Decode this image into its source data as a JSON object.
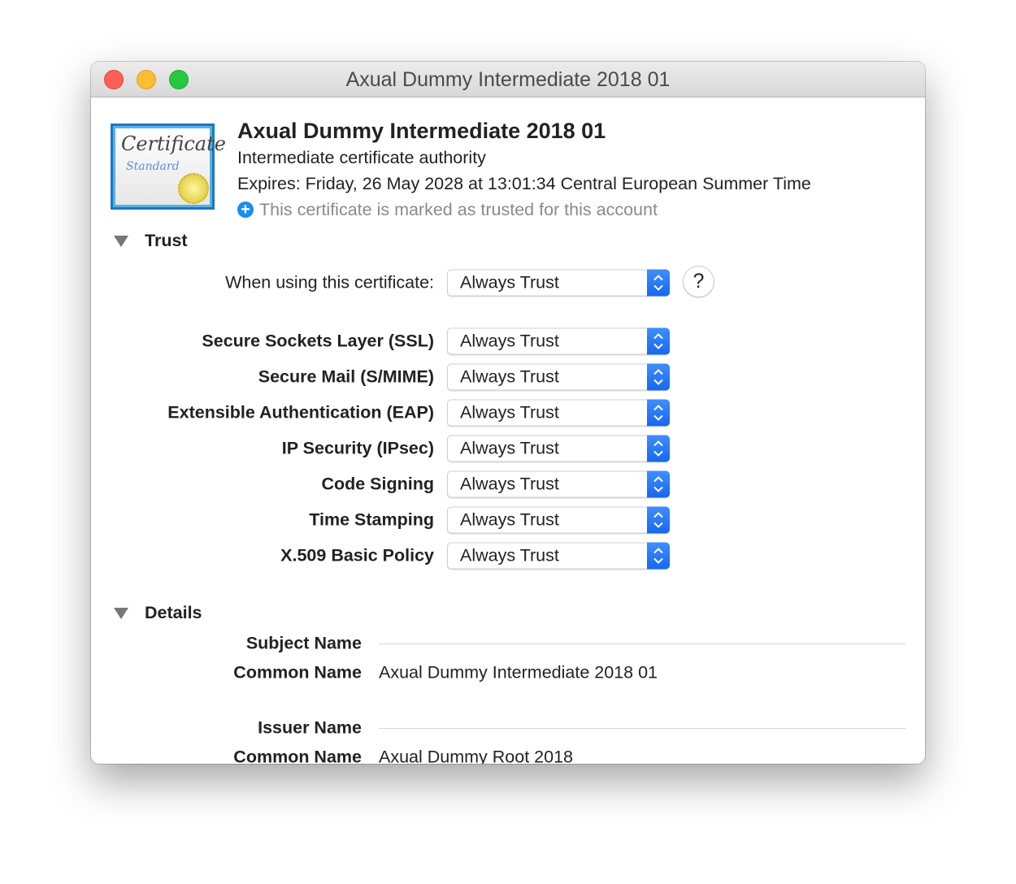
{
  "window": {
    "title": "Axual Dummy Intermediate 2018 01"
  },
  "header": {
    "icon": {
      "name": "certificate-standard-icon",
      "text": [
        "Certificate",
        "Standard"
      ]
    },
    "name": "Axual Dummy Intermediate 2018 01",
    "type": "Intermediate certificate authority",
    "expires": "Expires: Friday, 26 May 2028 at 13:01:34 Central European Summer Time",
    "trust_status": "This certificate is marked as trusted for this account"
  },
  "trust": {
    "label": "Trust",
    "when_using_label": "When using this certificate:",
    "when_using_value": "Always Trust",
    "help": "?",
    "policies": [
      {
        "label": "Secure Sockets Layer (SSL)",
        "value": "Always Trust"
      },
      {
        "label": "Secure Mail (S/MIME)",
        "value": "Always Trust"
      },
      {
        "label": "Extensible Authentication (EAP)",
        "value": "Always Trust"
      },
      {
        "label": "IP Security (IPsec)",
        "value": "Always Trust"
      },
      {
        "label": "Code Signing",
        "value": "Always Trust"
      },
      {
        "label": "Time Stamping",
        "value": "Always Trust"
      },
      {
        "label": "X.509 Basic Policy",
        "value": "Always Trust"
      }
    ]
  },
  "details": {
    "label": "Details",
    "subject_header": "Subject Name",
    "subject_cn_label": "Common Name",
    "subject_cn": "Axual Dummy Intermediate 2018 01",
    "issuer_header": "Issuer Name",
    "issuer_cn_label": "Common Name",
    "issuer_cn": "Axual Dummy Root 2018"
  },
  "colors": {
    "accent": "#1a6ff3",
    "close": "#fe5f57",
    "minimize": "#febc2e",
    "zoom": "#28c840"
  }
}
